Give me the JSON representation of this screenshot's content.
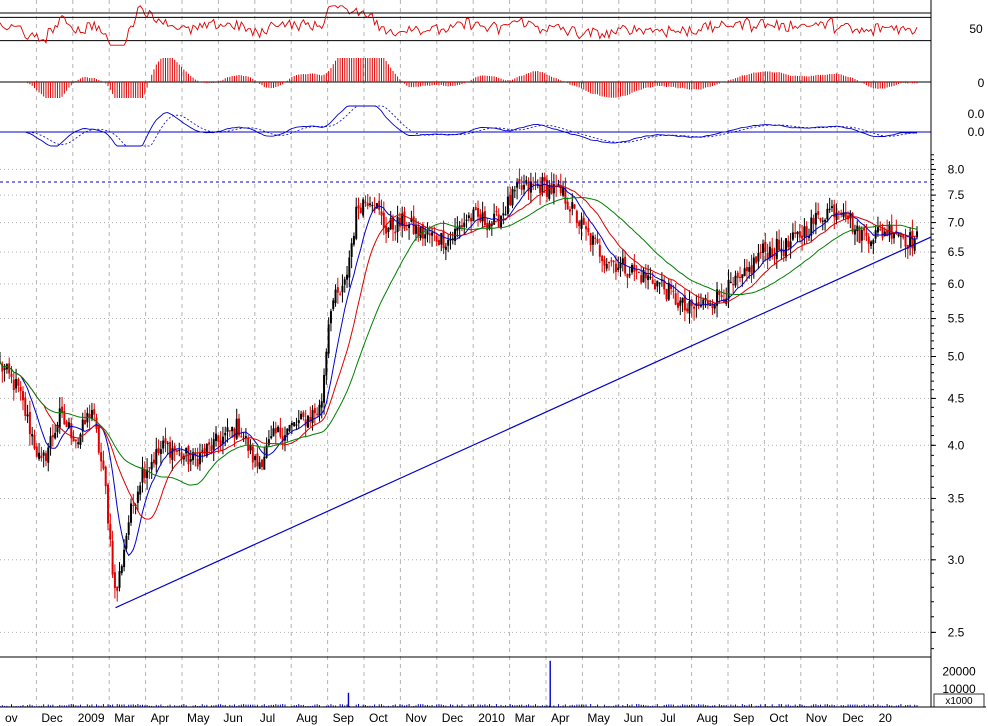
{
  "chart_data": {
    "type": "candlestick",
    "title": "",
    "x_months": [
      "ov",
      "Dec",
      "2009",
      "Mar",
      "Apr",
      "May",
      "Jun",
      "Jul",
      "Aug",
      "Sep",
      "Oct",
      "Nov",
      "Dec",
      "2010",
      "Mar",
      "Apr",
      "May",
      "Jun",
      "Jul",
      "Aug",
      "Sep",
      "Oct",
      "Nov",
      "Dec",
      "20"
    ],
    "panels": [
      {
        "name": "oscillator",
        "ticks": [
          "50"
        ],
        "levels": [
          70,
          30
        ],
        "ylim": [
          0,
          100
        ]
      },
      {
        "name": "histogram",
        "ticks": [
          "0"
        ],
        "ylim": [
          -1,
          1
        ]
      },
      {
        "name": "macd",
        "ticks": [
          "0.0",
          "0.0"
        ],
        "ylim": [
          -1,
          1
        ]
      },
      {
        "name": "price",
        "log_scale": true,
        "ylim": [
          2.35,
          8.4
        ],
        "ticks": [
          "8.0",
          "7.5",
          "7.0",
          "6.5",
          "6.0",
          "5.5",
          "5.0",
          "4.5",
          "4.0",
          "3.5",
          "3.0",
          "2.5"
        ],
        "resistance_level": 7.75,
        "trendline": [
          {
            "x": 0.126,
            "y": 2.66
          },
          {
            "x": 1.0,
            "y": 6.75
          }
        ],
        "anchors": [
          {
            "x": 0.0,
            "y": 4.9
          },
          {
            "x": 0.02,
            "y": 4.6
          },
          {
            "x": 0.045,
            "y": 3.8
          },
          {
            "x": 0.065,
            "y": 4.3
          },
          {
            "x": 0.085,
            "y": 4.05
          },
          {
            "x": 0.1,
            "y": 4.4
          },
          {
            "x": 0.115,
            "y": 3.6
          },
          {
            "x": 0.126,
            "y": 2.72
          },
          {
            "x": 0.14,
            "y": 3.3
          },
          {
            "x": 0.155,
            "y": 3.75
          },
          {
            "x": 0.18,
            "y": 4.0
          },
          {
            "x": 0.21,
            "y": 3.85
          },
          {
            "x": 0.24,
            "y": 4.05
          },
          {
            "x": 0.26,
            "y": 4.2
          },
          {
            "x": 0.28,
            "y": 3.8
          },
          {
            "x": 0.3,
            "y": 4.1
          },
          {
            "x": 0.33,
            "y": 4.25
          },
          {
            "x": 0.35,
            "y": 4.4
          },
          {
            "x": 0.36,
            "y": 5.7
          },
          {
            "x": 0.375,
            "y": 5.9
          },
          {
            "x": 0.39,
            "y": 7.3
          },
          {
            "x": 0.405,
            "y": 7.5
          },
          {
            "x": 0.42,
            "y": 6.9
          },
          {
            "x": 0.44,
            "y": 7.0
          },
          {
            "x": 0.46,
            "y": 6.8
          },
          {
            "x": 0.49,
            "y": 6.7
          },
          {
            "x": 0.51,
            "y": 7.1
          },
          {
            "x": 0.54,
            "y": 7.0
          },
          {
            "x": 0.565,
            "y": 7.6
          },
          {
            "x": 0.59,
            "y": 7.7
          },
          {
            "x": 0.615,
            "y": 7.5
          },
          {
            "x": 0.635,
            "y": 6.9
          },
          {
            "x": 0.66,
            "y": 6.4
          },
          {
            "x": 0.69,
            "y": 6.2
          },
          {
            "x": 0.72,
            "y": 6.0
          },
          {
            "x": 0.75,
            "y": 5.6
          },
          {
            "x": 0.78,
            "y": 5.8
          },
          {
            "x": 0.81,
            "y": 6.05
          },
          {
            "x": 0.83,
            "y": 6.5
          },
          {
            "x": 0.86,
            "y": 6.6
          },
          {
            "x": 0.88,
            "y": 6.9
          },
          {
            "x": 0.9,
            "y": 7.2
          },
          {
            "x": 0.92,
            "y": 7.3
          },
          {
            "x": 0.935,
            "y": 6.8
          },
          {
            "x": 0.955,
            "y": 6.8
          },
          {
            "x": 0.975,
            "y": 6.9
          },
          {
            "x": 0.99,
            "y": 6.7
          }
        ],
        "ma_periods": [
          10,
          20,
          40
        ]
      },
      {
        "name": "volume",
        "ticks": [
          "20000",
          "10000"
        ],
        "unit": "x1000",
        "ylim": [
          0,
          27000
        ],
        "spikes": [
          {
            "x": 0.38,
            "v": 8000
          },
          {
            "x": 0.6,
            "v": 26000
          }
        ]
      }
    ]
  },
  "colors": {
    "frame": "#000000",
    "grid": "#b4b4b4",
    "up": "#000000",
    "down": "#e00000",
    "ma_fast": "#0000cc",
    "ma_mid": "#dd0000",
    "ma_slow": "#008000",
    "trendline": "#0000cc",
    "resistance": "#0000cc",
    "oscillator": "#dd0000",
    "histogram": "#dd0000",
    "macd_signal": "#0000cc",
    "volume": "#0000cc"
  }
}
